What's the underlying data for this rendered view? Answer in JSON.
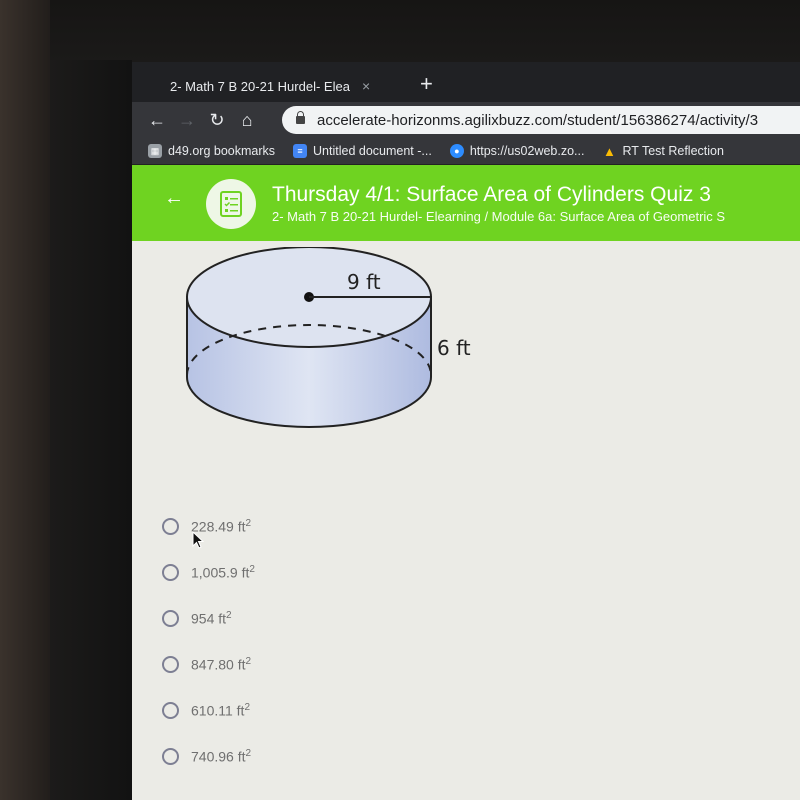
{
  "browser": {
    "tab_title": "2- Math 7 B 20-21 Hurdel- Elearn",
    "tab_close": "×",
    "new_tab": "+",
    "url": "accelerate-horizonms.agilixbuzz.com/student/156386274/activity/3",
    "bookmarks": [
      {
        "label": "d49.org bookmarks",
        "icon": "folder-icon",
        "color": "#9aa0a6"
      },
      {
        "label": "Untitled document -...",
        "icon": "docs-icon",
        "color": "#4285f4"
      },
      {
        "label": "https://us02web.zo...",
        "icon": "zoom-icon",
        "color": "#2d8cff"
      },
      {
        "label": "RT Test Reflection",
        "icon": "drive-icon",
        "color": "#fbbc04"
      }
    ]
  },
  "header": {
    "title": "Thursday 4/1: Surface Area of Cylinders Quiz 3",
    "subtitle": "2- Math 7 B 20-21 Hurdel- Elearning / Module 6a: Surface Area of Geometric S",
    "accent": "#6fd321"
  },
  "figure": {
    "radius_label": "9 ft",
    "height_label": "6 ft"
  },
  "question": {
    "choices": [
      {
        "value": "228.49 ft",
        "unit_exp": "2"
      },
      {
        "value": "1,005.9 ft",
        "unit_exp": "2"
      },
      {
        "value": "954 ft",
        "unit_exp": "2"
      },
      {
        "value": "847.80 ft",
        "unit_exp": "2"
      },
      {
        "value": "610.11 ft",
        "unit_exp": "2"
      },
      {
        "value": "740.96 ft",
        "unit_exp": "2"
      }
    ]
  }
}
